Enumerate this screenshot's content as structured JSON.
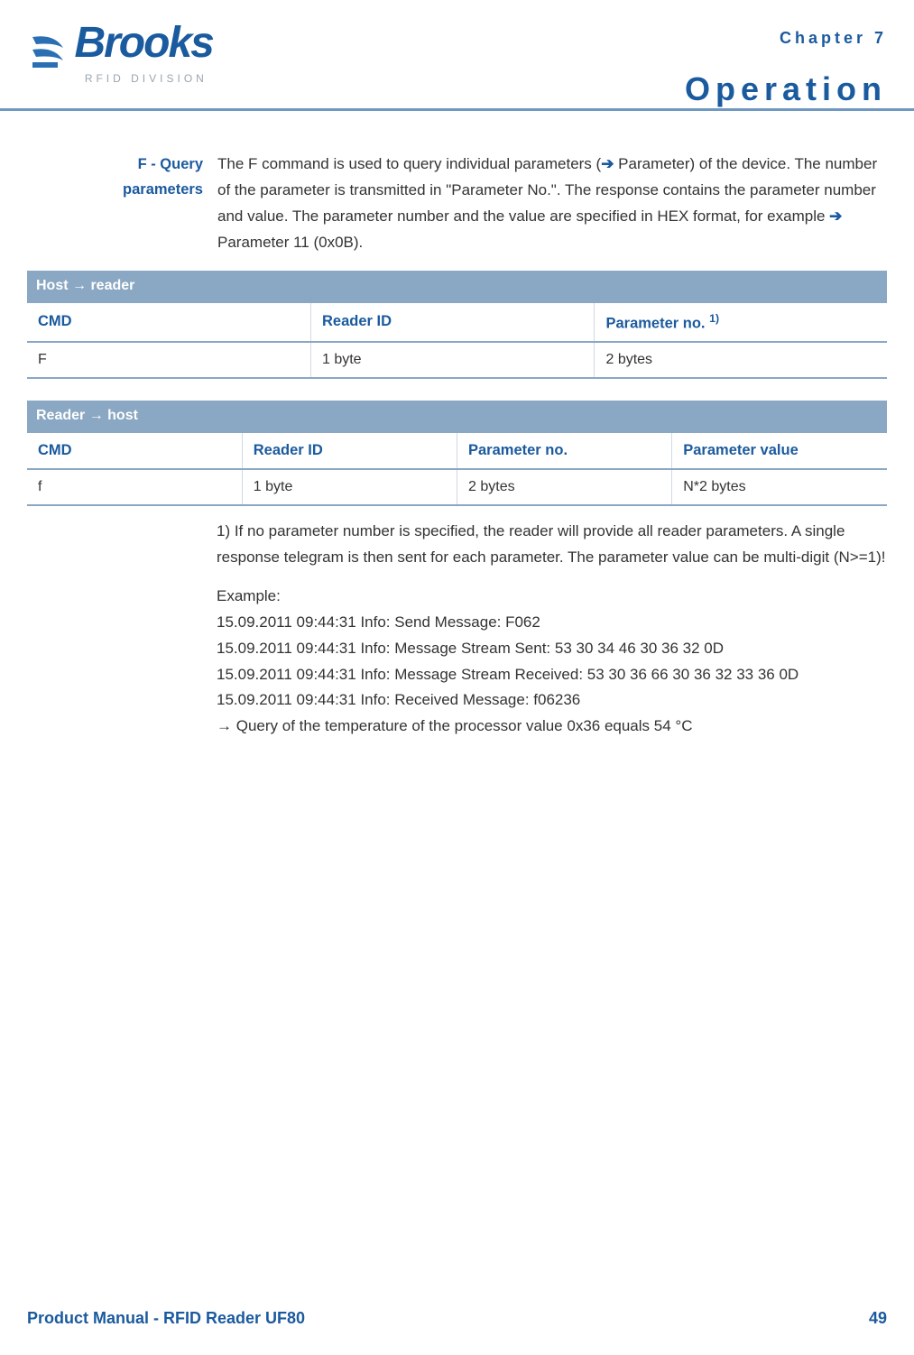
{
  "header": {
    "logo_text": "Brooks",
    "logo_sub": "RFID DIVISION",
    "chapter": "Chapter 7",
    "section": "Operation"
  },
  "section": {
    "sidelabel_line1": "F - Query",
    "sidelabel_line2": "parameters",
    "intro_pre": "The F command is used to query individual parameters (",
    "intro_mid": " Parameter) of the device. The number of the parameter is transmitted in \"Parameter No.\". The response contains the parameter number and value. The parameter number and the value are specified in HEX format, for example ",
    "intro_post": " Parameter 11 (0x0B).",
    "arrow": "➔"
  },
  "table1": {
    "banner": "Host → reader",
    "headers": [
      "CMD",
      "Reader ID",
      "Parameter no."
    ],
    "header_sup": "1)",
    "row": [
      "F",
      "1 byte",
      "2 bytes"
    ]
  },
  "table2": {
    "banner": "Reader → host",
    "headers": [
      "CMD",
      "Reader ID",
      "Parameter no.",
      "Parameter value"
    ],
    "row": [
      "f",
      "1 byte",
      "2 bytes",
      "N*2 bytes"
    ]
  },
  "note": "1) If no parameter number is specified, the reader will provide all reader parameters. A single response telegram is then sent for each parameter. The parameter value can be multi-digit (N>=1)!",
  "example": {
    "label": "Example:",
    "lines": [
      "15.09.2011 09:44:31 Info: Send Message: F062",
      "15.09.2011 09:44:31 Info: Message Stream Sent: 53 30 34 46 30 36 32 0D",
      "15.09.2011 09:44:31 Info: Message Stream Received: 53 30 36 66 30 36 32 33 36 0D",
      "15.09.2011 09:44:31 Info: Received Message: f06236",
      "→ Query of the temperature of the processor value 0x36 equals 54 °C"
    ]
  },
  "footer": {
    "left": "Product Manual - RFID Reader UF80",
    "right": "49"
  }
}
